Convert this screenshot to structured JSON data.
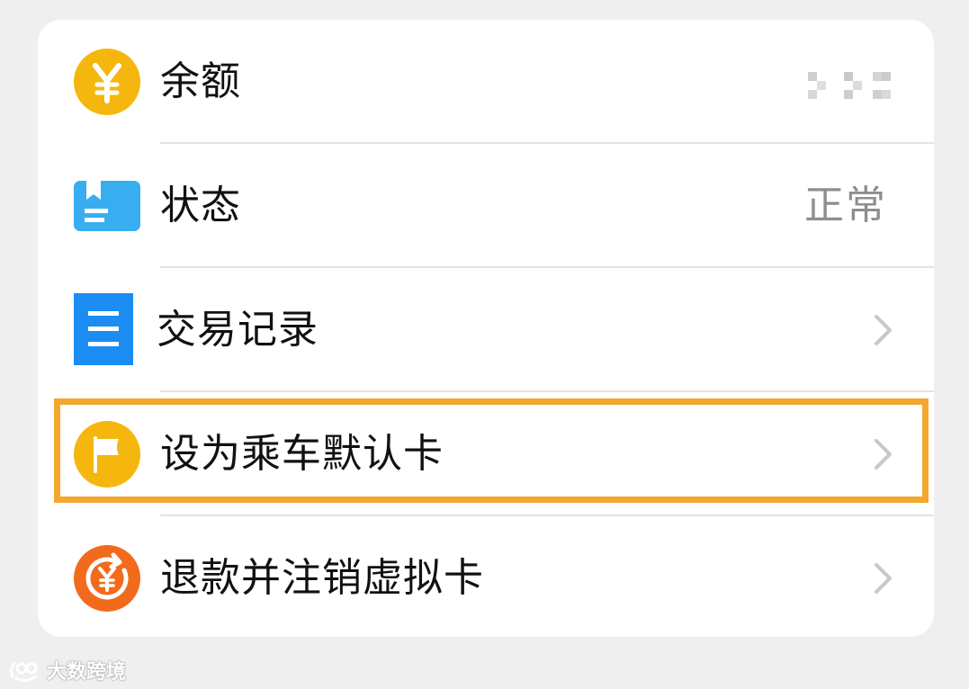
{
  "rows": [
    {
      "label": "余额",
      "value": "",
      "icon": "yuan-icon"
    },
    {
      "label": "状态",
      "value": "正常",
      "icon": "card-status-icon"
    },
    {
      "label": "交易记录",
      "icon": "list-icon"
    },
    {
      "label": "设为乘车默认卡",
      "icon": "flag-icon"
    },
    {
      "label": "退款并注销虚拟卡",
      "icon": "refund-icon"
    }
  ],
  "colors": {
    "highlight": "#f3a72c",
    "yellow": "#f5b70e",
    "blue": "#1a8cf2",
    "orange": "#f26b1d"
  },
  "watermark": "大数跨境"
}
